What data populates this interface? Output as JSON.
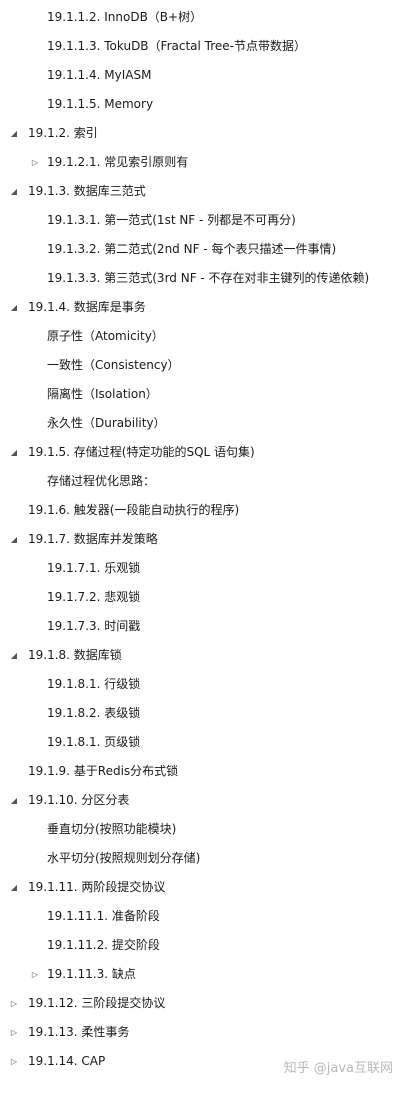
{
  "tree": [
    {
      "label": "19.1.1.2. InnoDB（B+树）",
      "level": 3,
      "toggle": "none"
    },
    {
      "label": "19.1.1.3. TokuDB（Fractal Tree-节点带数据）",
      "level": 3,
      "toggle": "none"
    },
    {
      "label": "19.1.1.4.  MyIASM",
      "level": 3,
      "toggle": "none"
    },
    {
      "label": "19.1.1.5. Memory",
      "level": 3,
      "toggle": "none"
    },
    {
      "label": "19.1.2. 索引",
      "level": 2,
      "toggle": "expanded"
    },
    {
      "label": "19.1.2.1. 常见索引原则有",
      "level": 3,
      "toggle": "collapsed"
    },
    {
      "label": "19.1.3. 数据库三范式",
      "level": 2,
      "toggle": "expanded"
    },
    {
      "label": "19.1.3.1. 第一范式(1st NF  - 列都是不可再分)",
      "level": 3,
      "toggle": "none"
    },
    {
      "label": "19.1.3.2. 第二范式(2nd NF - 每个表只描述一件事情)",
      "level": 3,
      "toggle": "none"
    },
    {
      "label": "19.1.3.3. 第三范式(3rd NF -  不存在对非主键列的传递依赖)",
      "level": 3,
      "toggle": "none"
    },
    {
      "label": "19.1.4. 数据库是事务",
      "level": 2,
      "toggle": "expanded"
    },
    {
      "label": "原子性（Atomicity）",
      "level": 3,
      "toggle": "none"
    },
    {
      "label": "一致性（Consistency）",
      "level": 3,
      "toggle": "none"
    },
    {
      "label": "隔离性（Isolation）",
      "level": 3,
      "toggle": "none"
    },
    {
      "label": "永久性（Durability）",
      "level": 3,
      "toggle": "none"
    },
    {
      "label": "19.1.5. 存储过程(特定功能的SQL 语句集)",
      "level": 2,
      "toggle": "expanded"
    },
    {
      "label": "存储过程优化思路：",
      "level": 3,
      "toggle": "none"
    },
    {
      "label": "19.1.6. 触发器(一段能自动执行的程序)",
      "level": 2,
      "toggle": "none"
    },
    {
      "label": "19.1.7. 数据库并发策略",
      "level": 2,
      "toggle": "expanded"
    },
    {
      "label": "19.1.7.1. 乐观锁",
      "level": 3,
      "toggle": "none"
    },
    {
      "label": "19.1.7.2. 悲观锁",
      "level": 3,
      "toggle": "none"
    },
    {
      "label": "19.1.7.3.  时间戳",
      "level": 3,
      "toggle": "none"
    },
    {
      "label": "19.1.8. 数据库锁",
      "level": 2,
      "toggle": "expanded"
    },
    {
      "label": "19.1.8.1. 行级锁",
      "level": 3,
      "toggle": "none"
    },
    {
      "label": "19.1.8.2. 表级锁",
      "level": 3,
      "toggle": "none"
    },
    {
      "label": "19.1.8.1. 页级锁",
      "level": 3,
      "toggle": "none"
    },
    {
      "label": "19.1.9. 基于Redis分布式锁",
      "level": 2,
      "toggle": "none"
    },
    {
      "label": "19.1.10. 分区分表",
      "level": 2,
      "toggle": "expanded"
    },
    {
      "label": "垂直切分(按照功能模块)",
      "level": 3,
      "toggle": "none"
    },
    {
      "label": "水平切分(按照规则划分存储)",
      "level": 3,
      "toggle": "none"
    },
    {
      "label": "19.1.11. 两阶段提交协议",
      "level": 2,
      "toggle": "expanded"
    },
    {
      "label": "19.1.11.1.  准备阶段",
      "level": 3,
      "toggle": "none"
    },
    {
      "label": "19.1.11.2. 提交阶段",
      "level": 3,
      "toggle": "none"
    },
    {
      "label": "19.1.11.3. 缺点",
      "level": 3,
      "toggle": "collapsed"
    },
    {
      "label": "19.1.12. 三阶段提交协议",
      "level": 2,
      "toggle": "collapsed"
    },
    {
      "label": "19.1.13. 柔性事务",
      "level": 2,
      "toggle": "collapsed"
    },
    {
      "label": "19.1.14. CAP",
      "level": 2,
      "toggle": "collapsed"
    }
  ],
  "watermark": "知乎 @java互联网",
  "icons": {
    "expanded": "triangle-down-right-icon",
    "collapsed": "triangle-right-icon"
  }
}
